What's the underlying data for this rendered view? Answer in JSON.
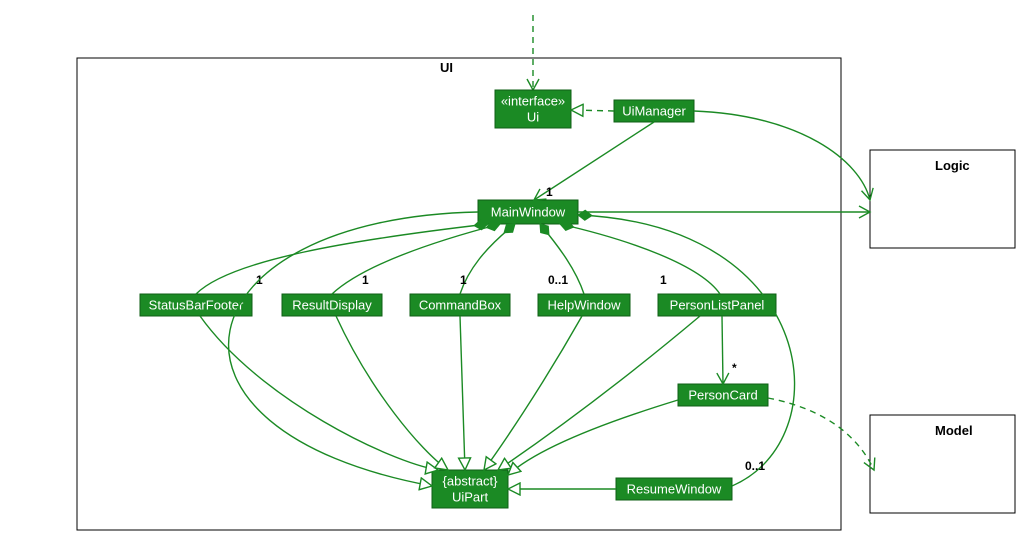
{
  "packages": {
    "ui": "UI",
    "logic": "Logic",
    "model": "Model"
  },
  "classes": {
    "uiInterface": {
      "stereotype": "«interface»",
      "name": "Ui"
    },
    "uiManager": "UiManager",
    "mainWindow": "MainWindow",
    "statusBarFooter": "StatusBarFooter",
    "resultDisplay": "ResultDisplay",
    "commandBox": "CommandBox",
    "helpWindow": "HelpWindow",
    "personListPanel": "PersonListPanel",
    "personCard": "PersonCard",
    "resumeWindow": "ResumeWindow",
    "uiPart": {
      "stereotype": "{abstract}",
      "name": "UiPart"
    }
  },
  "multiplicities": {
    "mainWindow": "1",
    "statusBarFooter": "1",
    "resultDisplay": "1",
    "commandBox": "1",
    "helpWindow": "0..1",
    "personListPanel": "1",
    "personCard": "*",
    "resumeWindow": "0..1"
  },
  "colors": {
    "accent": "#1b8a24"
  }
}
